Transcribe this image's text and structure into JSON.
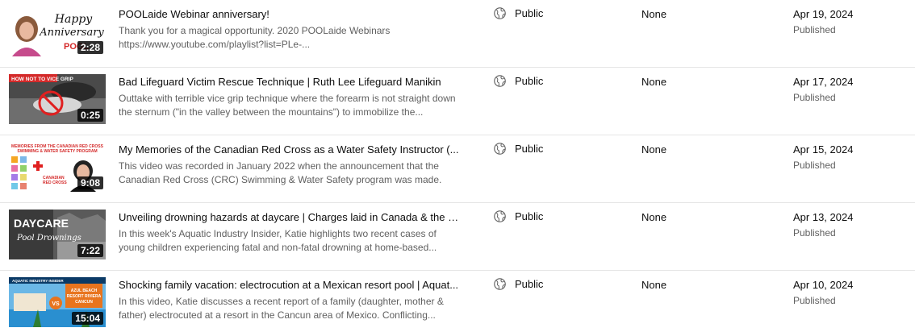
{
  "videos": [
    {
      "thumb_text": "Happy Anniversary",
      "thumb_logo": "POOL",
      "duration": "2:28",
      "title": "POOLaide Webinar anniversary!",
      "description": "Thank you for a magical opportunity. 2020 POOLaide Webinars https://www.youtube.com/playlist?list=PLe-...",
      "visibility": "Public",
      "restrictions": "None",
      "date": "Apr 19, 2024",
      "status": "Published"
    },
    {
      "thumb_text": "HOW NOT TO VICE GRIP",
      "duration": "0:25",
      "title": "Bad Lifeguard Victim Rescue Technique | Ruth Lee Lifeguard Manikin",
      "description": "Outtake with terrible vice grip technique where the forearm is not straight down the sternum (\"in the valley between the mountains\") to immobilize the...",
      "visibility": "Public",
      "restrictions": "None",
      "date": "Apr 17, 2024",
      "status": "Published"
    },
    {
      "thumb_text": "MEMORIES FROM THE CANADIAN RED CROSS SWIMMING & WATER SAFETY PROGRAM",
      "thumb_subtext": "CANADIAN RED CROSS",
      "duration": "9:08",
      "title": "My Memories of the Canadian Red Cross as a Water Safety Instructor (...",
      "description": "This video was recorded in January 2022 when the announcement that the Canadian Red Cross (CRC) Swimming & Water Safety program was made.",
      "visibility": "Public",
      "restrictions": "None",
      "date": "Apr 15, 2024",
      "status": "Published"
    },
    {
      "thumb_text": "DAYCARE",
      "thumb_subtext": "Pool Drownings",
      "duration": "7:22",
      "title": "Unveiling drowning hazards at daycare | Charges laid in Canada & the U...",
      "description": "In this week's Aquatic Industry Insider, Katie highlights two recent cases of young children experiencing fatal and non-fatal drowning at home-based...",
      "visibility": "Public",
      "restrictions": "None",
      "date": "Apr 13, 2024",
      "status": "Published"
    },
    {
      "thumb_text": "AQUATIC INDUSTRY INSIDER",
      "thumb_subtext": "AZUL BEACH RESORT RIVIERA CANCUN",
      "duration": "15:04",
      "title": "Shocking family vacation: electrocution at a Mexican resort pool | Aquat...",
      "description": "In this video, Katie discusses a recent report of a family (daughter, mother & father) electrocuted at a resort in the Cancun area of Mexico. Conflicting...",
      "visibility": "Public",
      "restrictions": "None",
      "date": "Apr 10, 2024",
      "status": "Published"
    }
  ],
  "icons": {
    "visibility": "globe-icon"
  },
  "colors": {
    "text_primary": "#0d0d0d",
    "text_secondary": "#606060",
    "divider": "#e5e5e5",
    "duration_bg": "#000000"
  }
}
